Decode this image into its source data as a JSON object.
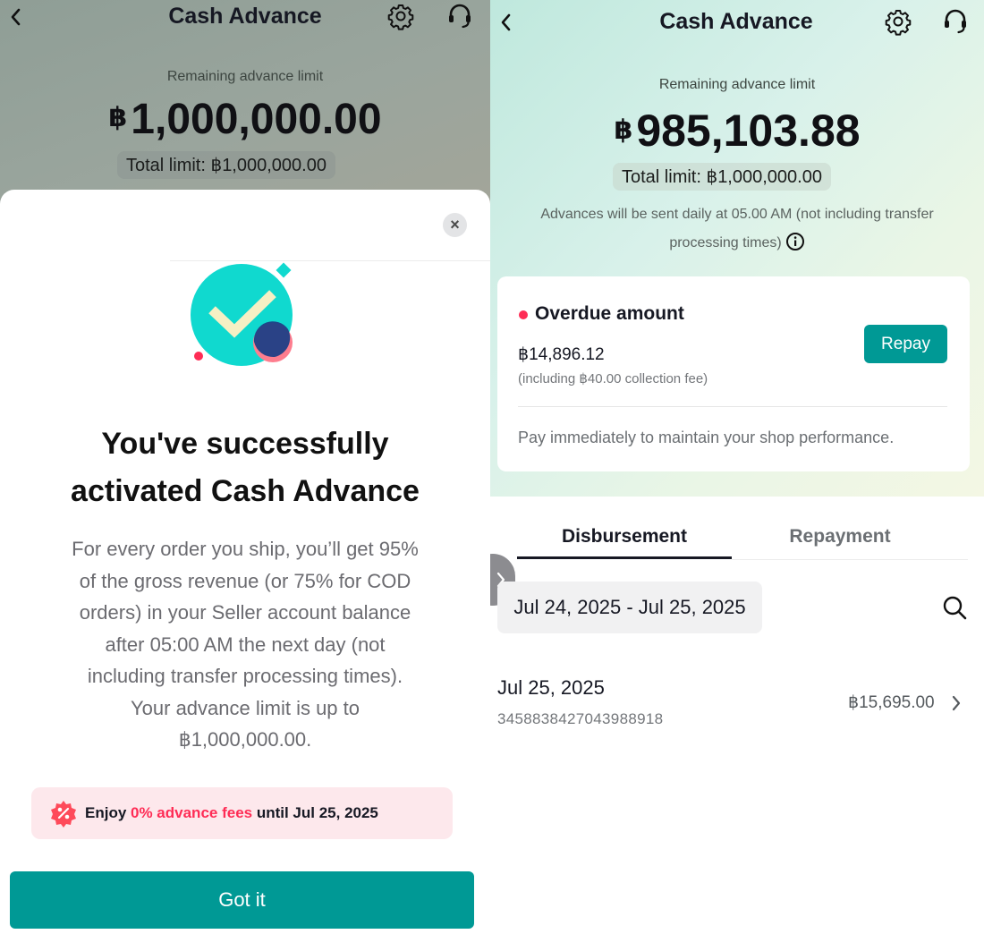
{
  "left": {
    "header": {
      "title": "Cash Advance"
    },
    "limit": {
      "label": "Remaining advance limit",
      "currency": "฿",
      "amount": "1,000,000.00",
      "total": "Total limit: ฿1,000,000.00"
    },
    "dialog": {
      "close_symbol": "×",
      "title_line1": "You've successfully",
      "title_line2": "activated Cash Advance",
      "description_lines": [
        "For every order you ship, you’ll get 95%",
        "of the gross revenue (or 75% for COD",
        "orders) in your Seller account balance",
        "after 05:00 AM the next day (not",
        "including transfer processing times).",
        "Your advance limit is up to",
        "฿1,000,000.00."
      ],
      "promo": {
        "before": "Enjoy ",
        "highlight": "0% advance fees",
        "after": " until Jul 25, 2025"
      },
      "button": "Got it"
    }
  },
  "right": {
    "header": {
      "title": "Cash Advance"
    },
    "limit": {
      "label": "Remaining advance limit",
      "currency": "฿",
      "amount": "985,103.88",
      "total": "Total limit: ฿1,000,000.00"
    },
    "note_line1": "Advances will be sent daily at 05.00 AM (not including transfer",
    "note_line2": "processing times)",
    "overdue": {
      "title": "Overdue amount",
      "amount": "฿14,896.12",
      "fee_note": "(including ฿40.00 collection fee)",
      "button": "Repay",
      "tip": "Pay immediately to maintain your shop performance."
    },
    "tabs": [
      "Disbursement",
      "Repayment"
    ],
    "active_tab": "Disbursement",
    "date_range": "Jul 24, 2025 - Jul 25, 2025",
    "records": [
      {
        "date": "Jul 25, 2025",
        "id": "3458838427043988918",
        "amount": "฿15,695.00"
      }
    ]
  },
  "colors": {
    "teal_button": "#009995",
    "accent_red": "#fe2c55",
    "illustration_teal": "#10d9cf"
  }
}
